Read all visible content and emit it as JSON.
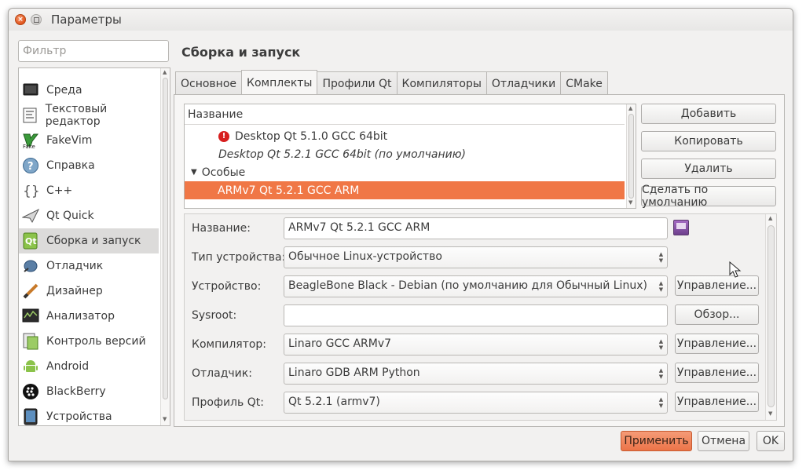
{
  "window": {
    "title": "Параметры"
  },
  "filter": {
    "placeholder": "Фильтр"
  },
  "categories": [
    {
      "label": "Среда",
      "icon": "monitor-icon"
    },
    {
      "label": "Текстовый редактор",
      "icon": "text-editor-icon"
    },
    {
      "label": "FakeVim",
      "icon": "fakevim-icon"
    },
    {
      "label": "Справка",
      "icon": "help-icon"
    },
    {
      "label": "C++",
      "icon": "cpp-braces-icon"
    },
    {
      "label": "Qt Quick",
      "icon": "qt-quick-icon"
    },
    {
      "label": "Сборка и запуск",
      "icon": "build-run-icon",
      "selected": true
    },
    {
      "label": "Отладчик",
      "icon": "debugger-icon"
    },
    {
      "label": "Дизайнер",
      "icon": "designer-icon"
    },
    {
      "label": "Анализатор",
      "icon": "analyzer-icon"
    },
    {
      "label": "Контроль версий",
      "icon": "version-control-icon"
    },
    {
      "label": "Android",
      "icon": "android-icon"
    },
    {
      "label": "BlackBerry",
      "icon": "blackberry-icon"
    },
    {
      "label": "Устройства",
      "icon": "devices-icon"
    }
  ],
  "section": {
    "title": "Сборка и запуск"
  },
  "tabs": [
    {
      "label": "Основное"
    },
    {
      "label": "Комплекты",
      "active": true
    },
    {
      "label": "Профили Qt"
    },
    {
      "label": "Компиляторы"
    },
    {
      "label": "Отладчики"
    },
    {
      "label": "CMake"
    }
  ],
  "kits": {
    "header": "Название",
    "rows": [
      {
        "label": "Desktop Qt 5.1.0 GCC 64bit",
        "icon": "error-icon"
      },
      {
        "label": "Desktop Qt 5.2.1 GCC 64bit (по умолчанию)",
        "italic": true
      },
      {
        "label": "Особые",
        "group": true
      },
      {
        "label": "ARMv7 Qt 5.2.1 GCC ARM",
        "selected": true
      }
    ]
  },
  "kit_buttons": {
    "add": "Добавить",
    "copy": "Копировать",
    "remove": "Удалить",
    "make_default": "Сделать по умолчанию"
  },
  "details": {
    "name_label": "Название:",
    "name_value": "ARMv7 Qt 5.2.1 GCC ARM",
    "device_type_label": "Тип устройства:",
    "device_type_value": "Обычное Linux-устройство",
    "device_label": "Устройство:",
    "device_value": "BeagleBone Black - Debian (по умолчанию для Обычный Linux)",
    "sysroot_label": "Sysroot:",
    "sysroot_value": "",
    "compiler_label": "Компилятор:",
    "compiler_value": "Linaro GCC ARMv7",
    "debugger_label": "Отладчик:",
    "debugger_value": "Linaro GDB ARM Python",
    "qt_profile_label": "Профиль Qt:",
    "qt_profile_value": "Qt 5.2.1 (armv7)",
    "manage": "Управление...",
    "browse": "Обзор..."
  },
  "footer": {
    "apply": "Применить",
    "cancel": "Отмена",
    "ok": "OK"
  },
  "colors": {
    "accent": "#f07746",
    "window_bg": "#f2f1f0"
  }
}
